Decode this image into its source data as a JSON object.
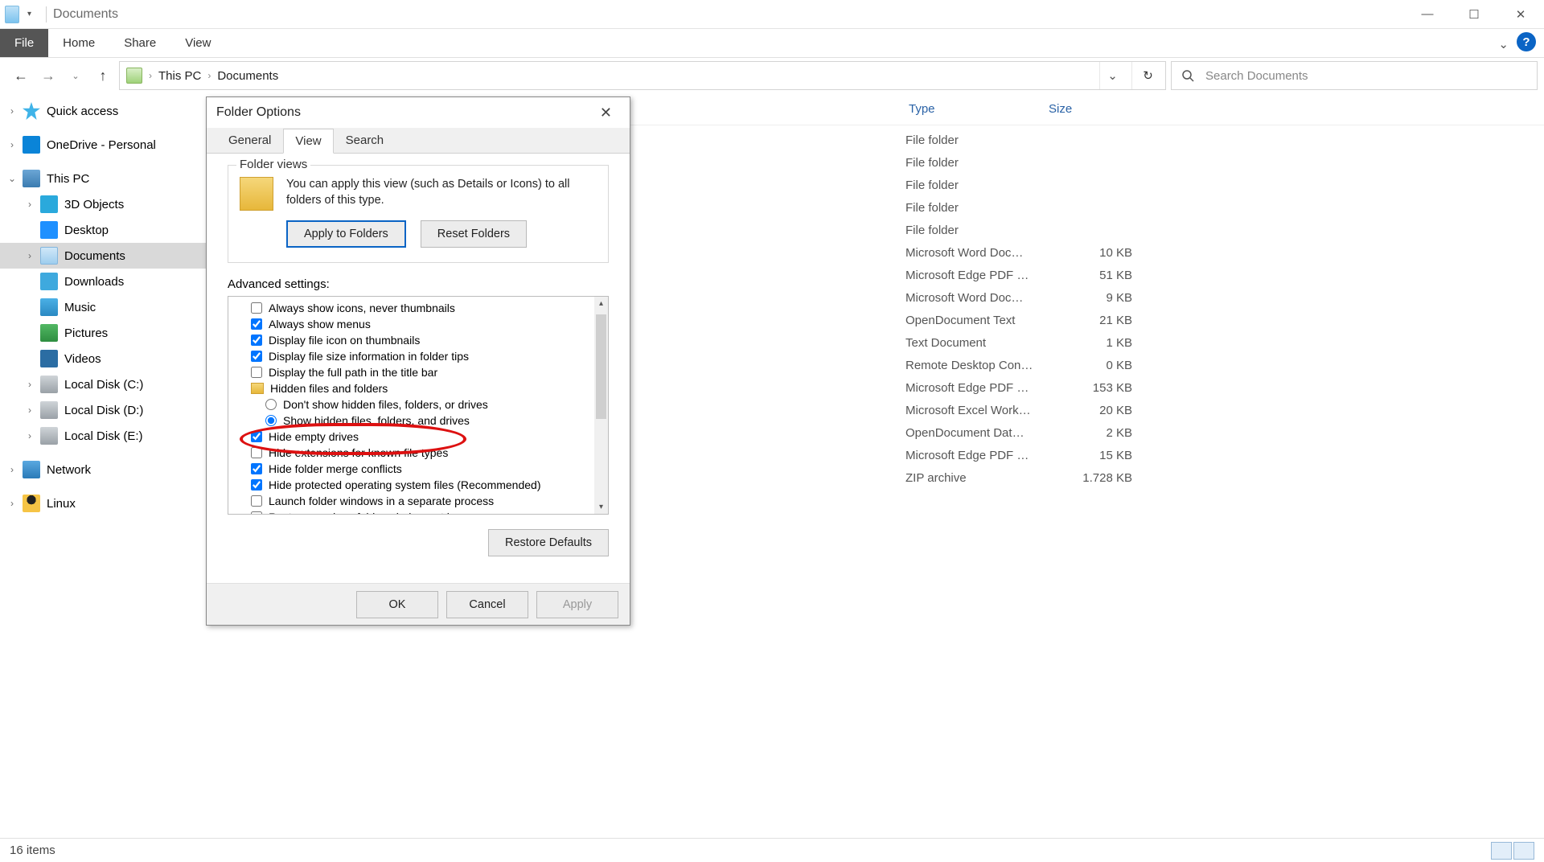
{
  "titlebar": {
    "title": "Documents"
  },
  "ribbon": {
    "file": "File",
    "home": "Home",
    "share": "Share",
    "view": "View"
  },
  "breadcrumbs": {
    "b1": "This PC",
    "b2": "Documents"
  },
  "search": {
    "placeholder": "Search Documents"
  },
  "sidebar": {
    "quick": "Quick access",
    "onedrive": "OneDrive - Personal",
    "thispc": "This PC",
    "obj3d": "3D Objects",
    "desktop": "Desktop",
    "documents": "Documents",
    "downloads": "Downloads",
    "music": "Music",
    "pictures": "Pictures",
    "videos": "Videos",
    "diskC": "Local Disk (C:)",
    "diskD": "Local Disk (D:)",
    "diskE": "Local Disk (E:)",
    "network": "Network",
    "linux": "Linux"
  },
  "columns": {
    "type": "Type",
    "size": "Size"
  },
  "files": [
    {
      "type": "File folder",
      "size": ""
    },
    {
      "type": "File folder",
      "size": ""
    },
    {
      "type": "File folder",
      "size": ""
    },
    {
      "type": "File folder",
      "size": ""
    },
    {
      "type": "File folder",
      "size": ""
    },
    {
      "type": "Microsoft Word Doc…",
      "size": "10 KB"
    },
    {
      "type": "Microsoft Edge PDF …",
      "size": "51 KB"
    },
    {
      "type": "Microsoft Word Doc…",
      "size": "9 KB"
    },
    {
      "type": "OpenDocument Text",
      "size": "21 KB"
    },
    {
      "type": "Text Document",
      "size": "1 KB"
    },
    {
      "type": "Remote Desktop Con…",
      "size": "0 KB"
    },
    {
      "type": "Microsoft Edge PDF …",
      "size": "153 KB"
    },
    {
      "type": "Microsoft Excel Work…",
      "size": "20 KB"
    },
    {
      "type": "OpenDocument Dat…",
      "size": "2 KB"
    },
    {
      "type": "Microsoft Edge PDF …",
      "size": "15 KB"
    },
    {
      "type": "ZIP archive",
      "size": "1.728 KB"
    }
  ],
  "status": {
    "items": "16 items"
  },
  "dialog": {
    "title": "Folder Options",
    "tabs": {
      "general": "General",
      "view": "View",
      "search": "Search"
    },
    "folder_views": {
      "legend": "Folder views",
      "text": "You can apply this view (such as Details or Icons) to all folders of this type.",
      "apply": "Apply to Folders",
      "reset": "Reset Folders"
    },
    "advanced_label": "Advanced settings:",
    "adv": {
      "i0": "Always show icons, never thumbnails",
      "i1": "Always show menus",
      "i2": "Display file icon on thumbnails",
      "i3": "Display file size information in folder tips",
      "i4": "Display the full path in the title bar",
      "hdr": "Hidden files and folders",
      "r0": "Don't show hidden files, folders, or drives",
      "r1": "Show hidden files, folders, and drives",
      "i5": "Hide empty drives",
      "i6": "Hide extensions for known file types",
      "i7": "Hide folder merge conflicts",
      "i8": "Hide protected operating system files (Recommended)",
      "i9": "Launch folder windows in a separate process",
      "i10": "Restore previous folder windows at logon"
    },
    "restore": "Restore Defaults",
    "ok": "OK",
    "cancel": "Cancel",
    "apply": "Apply"
  }
}
